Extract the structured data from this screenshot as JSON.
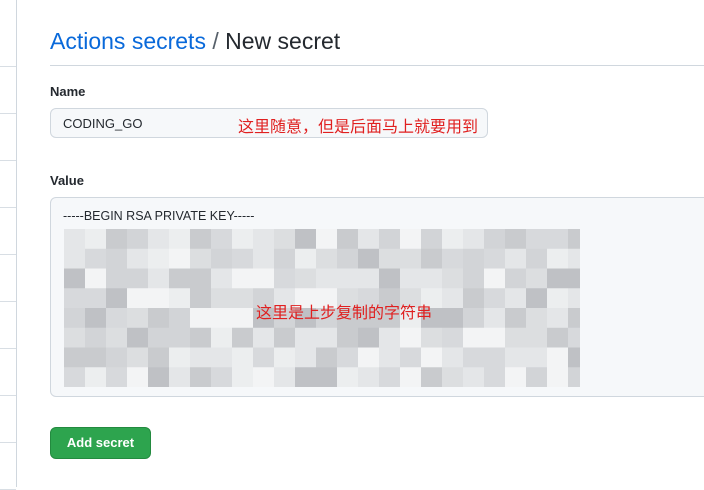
{
  "breadcrumb": {
    "parent": "Actions secrets",
    "separator": "/",
    "current": "New secret"
  },
  "form": {
    "name_label": "Name",
    "name_value": "CODING_GO",
    "value_label": "Value",
    "value_first_line": "-----BEGIN RSA PRIVATE KEY-----",
    "submit_label": "Add secret"
  },
  "annotations": {
    "name_note": "这里随意，但是后面马上就要用到",
    "value_note": "这里是上步复制的字符串"
  },
  "colors": {
    "link": "#0969da",
    "annotation": "#e02020",
    "button": "#2da44e"
  }
}
